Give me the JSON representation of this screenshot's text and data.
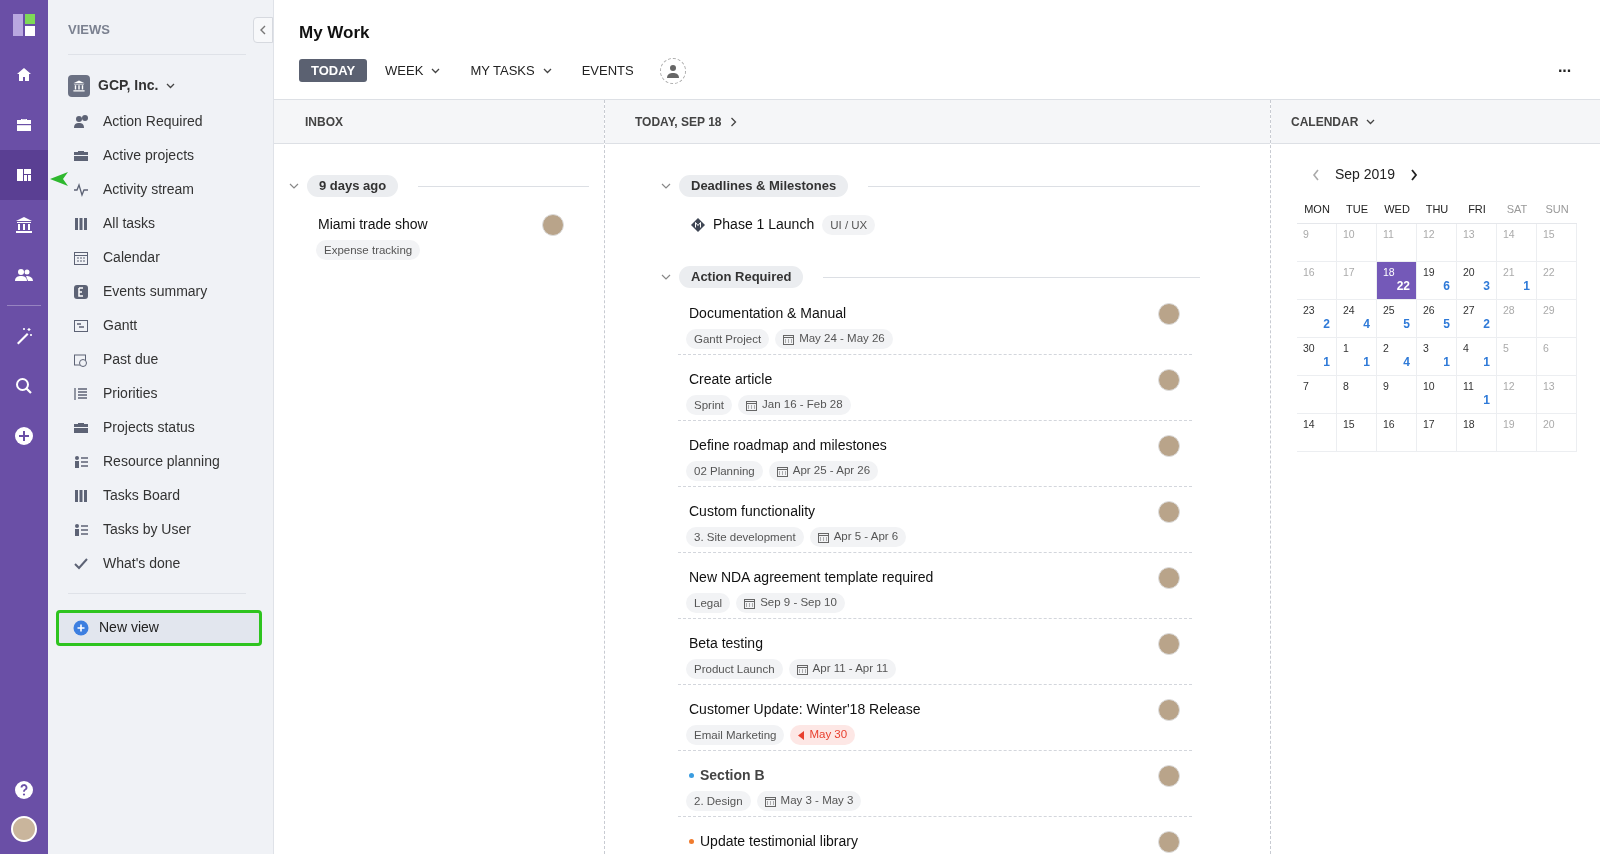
{
  "rail": {
    "items": [
      {
        "kind": "home",
        "selected": false
      },
      {
        "kind": "briefcase",
        "selected": false
      },
      {
        "kind": "views",
        "selected": true
      },
      {
        "kind": "bank",
        "selected": false
      },
      {
        "kind": "people",
        "selected": false
      },
      {
        "kind": "wand",
        "selected": false
      },
      {
        "kind": "search",
        "selected": false
      },
      {
        "kind": "plus",
        "selected": false
      }
    ]
  },
  "sidebar": {
    "title": "VIEWS",
    "workspace": "GCP, Inc.",
    "items": [
      {
        "label": "Action Required",
        "kind": "user-alert"
      },
      {
        "label": "Active projects",
        "kind": "briefcase"
      },
      {
        "label": "Activity stream",
        "kind": "pulse"
      },
      {
        "label": "All tasks",
        "kind": "columns"
      },
      {
        "label": "Calendar",
        "kind": "calendar"
      },
      {
        "label": "Events summary",
        "kind": "letter"
      },
      {
        "label": "Gantt",
        "kind": "gantt"
      },
      {
        "label": "Past due",
        "kind": "clock"
      },
      {
        "label": "Priorities",
        "kind": "list"
      },
      {
        "label": "Projects status",
        "kind": "briefcase"
      },
      {
        "label": "Resource planning",
        "kind": "people-list"
      },
      {
        "label": "Tasks Board",
        "kind": "columns"
      },
      {
        "label": "Tasks by User",
        "kind": "people-list"
      },
      {
        "label": "What's done",
        "kind": "check"
      }
    ],
    "new_view": {
      "label": "New view",
      "highlighted": true
    }
  },
  "header": {
    "title": "My Work",
    "tabs": [
      {
        "label": "TODAY",
        "selected": true,
        "dropdown": false
      },
      {
        "label": "WEEK",
        "selected": false,
        "dropdown": true
      },
      {
        "label": "MY TASKS",
        "selected": false,
        "dropdown": true
      },
      {
        "label": "EVENTS",
        "selected": false,
        "dropdown": false
      }
    ],
    "more": "···"
  },
  "inbox": {
    "title": "INBOX",
    "groups": [
      {
        "label": "9 days ago",
        "items": [
          {
            "title": "Miami trade show",
            "tag": "Expense tracking"
          }
        ]
      }
    ]
  },
  "today": {
    "title": "TODAY, SEP 18",
    "milestones": {
      "label": "Deadlines & Milestones",
      "items": [
        {
          "title": "Phase 1 Launch",
          "tag": "UI / UX"
        }
      ]
    },
    "action": {
      "label": "Action Required",
      "items": [
        {
          "title": "Documentation & Manual",
          "kind": "task",
          "tag": "Gantt Project",
          "date": "May 24 - May 26",
          "overdue": false
        },
        {
          "title": "Create article",
          "kind": "task",
          "tag": "Sprint",
          "date": "Jan 16 - Feb 28",
          "overdue": false
        },
        {
          "title": "Define roadmap and milestones",
          "kind": "task",
          "tag": "02 Planning",
          "date": "Apr 25 - Apr 26",
          "overdue": false
        },
        {
          "title": "Custom functionality",
          "kind": "task",
          "tag": "3. Site development",
          "date": "Apr 5 - Apr 6",
          "overdue": false
        },
        {
          "title": "New NDA agreement template required",
          "kind": "task",
          "tag": "Legal",
          "date": "Sep 9 - Sep 10",
          "overdue": false
        },
        {
          "title": "Beta testing",
          "kind": "task",
          "tag": "Product Launch",
          "date": "Apr 11 - Apr 11",
          "overdue": false
        },
        {
          "title": "Customer Update: Winter'18 Release",
          "kind": "task",
          "tag": "Email Marketing",
          "date": "May 30",
          "overdue": true
        },
        {
          "title": "Section B",
          "kind": "section",
          "color": "#3b9de0",
          "tag": "2. Design",
          "date": "May 3 - May 3",
          "overdue": false
        },
        {
          "title": "Update testimonial library",
          "kind": "task",
          "color": "#f07b2e"
        }
      ]
    }
  },
  "calendar": {
    "title": "CALENDAR",
    "month": "Sep 2019",
    "weekdays": [
      {
        "label": "MON",
        "weekend": false
      },
      {
        "label": "TUE",
        "weekend": false
      },
      {
        "label": "WED",
        "weekend": false
      },
      {
        "label": "THU",
        "weekend": false
      },
      {
        "label": "FRI",
        "weekend": false
      },
      {
        "label": "SAT",
        "weekend": true
      },
      {
        "label": "SUN",
        "weekend": true
      }
    ],
    "weeks": [
      [
        {
          "day": "9",
          "muted": true,
          "selected": false
        },
        {
          "day": "10",
          "muted": true,
          "selected": false
        },
        {
          "day": "11",
          "muted": true,
          "selected": false
        },
        {
          "day": "12",
          "muted": true,
          "selected": false
        },
        {
          "day": "13",
          "muted": true,
          "selected": false
        },
        {
          "day": "14",
          "muted": true,
          "selected": false
        },
        {
          "day": "15",
          "muted": true,
          "selected": false
        }
      ],
      [
        {
          "day": "16",
          "muted": true,
          "selected": false
        },
        {
          "day": "17",
          "muted": true,
          "selected": false
        },
        {
          "day": "18",
          "muted": false,
          "selected": true,
          "count": "22"
        },
        {
          "day": "19",
          "muted": false,
          "selected": false,
          "count": "6"
        },
        {
          "day": "20",
          "muted": false,
          "selected": false,
          "count": "3"
        },
        {
          "day": "21",
          "muted": true,
          "selected": false,
          "count": "1"
        },
        {
          "day": "22",
          "muted": true,
          "selected": false
        }
      ],
      [
        {
          "day": "23",
          "muted": false,
          "selected": false,
          "count": "2"
        },
        {
          "day": "24",
          "muted": false,
          "selected": false,
          "count": "4"
        },
        {
          "day": "25",
          "muted": false,
          "selected": false,
          "count": "5"
        },
        {
          "day": "26",
          "muted": false,
          "selected": false,
          "count": "5"
        },
        {
          "day": "27",
          "muted": false,
          "selected": false,
          "count": "2"
        },
        {
          "day": "28",
          "muted": true,
          "selected": false
        },
        {
          "day": "29",
          "muted": true,
          "selected": false
        }
      ],
      [
        {
          "day": "30",
          "muted": false,
          "selected": false,
          "count": "1"
        },
        {
          "day": "1",
          "muted": false,
          "selected": false,
          "count": "1"
        },
        {
          "day": "2",
          "muted": false,
          "selected": false,
          "count": "4"
        },
        {
          "day": "3",
          "muted": false,
          "selected": false,
          "count": "1"
        },
        {
          "day": "4",
          "muted": false,
          "selected": false,
          "count": "1"
        },
        {
          "day": "5",
          "muted": true,
          "selected": false
        },
        {
          "day": "6",
          "muted": true,
          "selected": false
        }
      ],
      [
        {
          "day": "7",
          "muted": false,
          "selected": false
        },
        {
          "day": "8",
          "muted": false,
          "selected": false
        },
        {
          "day": "9",
          "muted": false,
          "selected": false
        },
        {
          "day": "10",
          "muted": false,
          "selected": false
        },
        {
          "day": "11",
          "muted": false,
          "selected": false,
          "count": "1"
        },
        {
          "day": "12",
          "muted": true,
          "selected": false
        },
        {
          "day": "13",
          "muted": true,
          "selected": false
        }
      ],
      [
        {
          "day": "14",
          "muted": false,
          "selected": false
        },
        {
          "day": "15",
          "muted": false,
          "selected": false
        },
        {
          "day": "16",
          "muted": false,
          "selected": false
        },
        {
          "day": "17",
          "muted": false,
          "selected": false
        },
        {
          "day": "18",
          "muted": false,
          "selected": false
        },
        {
          "day": "19",
          "muted": true,
          "selected": false
        },
        {
          "day": "20",
          "muted": true,
          "selected": false
        }
      ]
    ]
  }
}
